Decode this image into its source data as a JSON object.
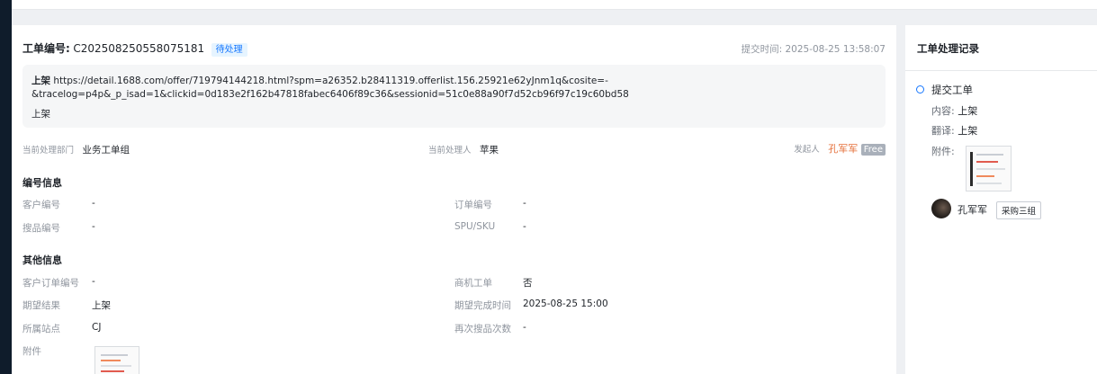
{
  "ticket": {
    "number_label": "工单编号:",
    "number": "C202508250558075181",
    "status": "待处理",
    "submit_time_label": "提交时间:",
    "submit_time": "2025-08-25 13:58:07"
  },
  "content": {
    "line1_prefix": "上架",
    "line1_url": "https://detail.1688.com/offer/719794144218.html?spm=a26352.b28411319.offerlist.156.25921e62yJnm1q&cosite=-",
    "line2": "&tracelog=p4p&_p_isad=1&clickid=0d183e2f162b47818fabec6406f89c36&sessionid=51c0e88a90f7d52cb96f97c19c60bd58",
    "line3": "上架"
  },
  "meta": {
    "dept_label": "当前处理部门",
    "dept": "业务工单组",
    "handler_label": "当前处理人",
    "handler": "苹果",
    "initiator_label": "发起人",
    "initiator": "孔军军",
    "plan_tag": "Free"
  },
  "number_info": {
    "title": "编号信息",
    "customer_no_label": "客户编号",
    "customer_no": "-",
    "order_no_label": "订单编号",
    "order_no": "-",
    "search_no_label": "搜品编号",
    "search_no": "-",
    "spu_label": "SPU/SKU",
    "spu": "-"
  },
  "other_info": {
    "title": "其他信息",
    "customer_order_label": "客户订单编号",
    "customer_order": "-",
    "biz_ticket_label": "商机工单",
    "biz_ticket": "否",
    "expected_result_label": "期望结果",
    "expected_result": "上架",
    "expected_time_label": "期望完成时间",
    "expected_time": "2025-08-25 15:00",
    "site_label": "所属站点",
    "site": "CJ",
    "research_count_label": "再次搜品次数",
    "research_count": "-",
    "attachment_label": "附件"
  },
  "records": {
    "title": "工单处理记录",
    "item_title": "提交工单",
    "content_label": "内容:",
    "content": "上架",
    "translation_label": "翻译:",
    "translation": "上架",
    "attachment_label": "附件:",
    "user": "孔军军",
    "group": "采购三组"
  },
  "colors": {
    "accent": "#1677ff",
    "initiator": "#e5703b",
    "sidebar_dark": "#0f1c2b"
  }
}
